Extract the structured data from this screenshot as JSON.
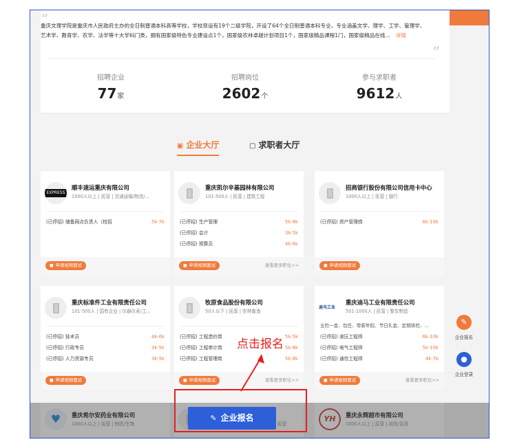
{
  "intro": {
    "text": "重庆文理学院是重庆市人民政府主办的全日制普通本科高等学校，学校现设有19个二级学院，开设了64个全日制普通本科专业，专业涵盖文学、理学、工学、管理学、艺术学、教育学、农学、法学等十大学科门类，拥有国家级特色专业建设点1个，国家级农林卓越计划项目1个，国家级精品课程1门，国家级精品在线...",
    "more_label": "详情"
  },
  "stats": [
    {
      "label": "招聘企业",
      "value": "77",
      "unit": "家"
    },
    {
      "label": "招聘岗位",
      "value": "2602",
      "unit": "个"
    },
    {
      "label": "参与求职者",
      "value": "9612",
      "unit": "人"
    }
  ],
  "tabs": [
    {
      "label": "企业大厅",
      "icon": "building-icon",
      "active": true
    },
    {
      "label": "求职者大厅",
      "icon": "briefcase-icon",
      "active": false
    }
  ],
  "companies": [
    {
      "name": "顺丰速运重庆有限公司",
      "meta": "1000人以上 | 民营 | 交通运输/物流/...",
      "logo": "sf-express-logo",
      "logo_text": "EXPRESS",
      "jobs": [
        {
          "title": "(已停招) 储备网点负责人（校招",
          "salary": "5k-7k"
        }
      ],
      "more_label": ""
    },
    {
      "name": "重庆凯尔辛基园林有限公司",
      "meta": "101-500人 | 民营 | 建筑工程",
      "logo": "building-icon",
      "jobs": [
        {
          "title": "(已停招) 生产管理",
          "salary": "5k-8k"
        },
        {
          "title": "(已停招) 会计",
          "salary": "3k-5k"
        },
        {
          "title": "(已停招) 预算员",
          "salary": "4k-6k"
        }
      ],
      "more_label": "查看更多职位>>"
    },
    {
      "name": "招商银行股份有限公司信用卡中心",
      "meta": "1000人以上 | 民营 | 银行",
      "logo": "building-icon",
      "jobs": [
        {
          "title": "(已停招) 资产管理岗",
          "salary": "6k-10k"
        }
      ],
      "more_label": ""
    },
    {
      "name": "重庆标准件工业有限责任公司",
      "meta": "101-500人 | 国有企业 | 仪器仪表/工...",
      "logo": "building-icon",
      "jobs": [
        {
          "title": "(已停招) 技术员",
          "salary": "4k-6k"
        },
        {
          "title": "(已停招) 行政专员",
          "salary": "3k-5k"
        },
        {
          "title": "(已停招) 人力资源专员",
          "salary": "3k-5k"
        }
      ],
      "more_label": ""
    },
    {
      "name": "牧原食品股份有限公司",
      "meta": "50人以下 | 民营 | 农林畜渔",
      "logo": "building-icon",
      "jobs": [
        {
          "title": "(已停招) 工程造价岗",
          "salary": "5k-5k"
        },
        {
          "title": "(已停招) 工程审计岗",
          "salary": "5k-8k"
        },
        {
          "title": "(已停招) 工程管理岗",
          "salary": "5k-8k"
        }
      ],
      "more_label": "查看更多职位>>"
    },
    {
      "name": "重庆迪马工业有限责任公司",
      "meta": "501-1000人 | 民营 | 整车制造",
      "logo": "dima-logo",
      "logo_text": "迪马工业",
      "benefits": "五险一金、包住、带薪年假、节日礼金、定期体检、...",
      "jobs": [
        {
          "title": "(已停招) 液压工程师",
          "salary": "6k-10k"
        },
        {
          "title": "(已停招) 电气工程师",
          "salary": "5k-10k"
        },
        {
          "title": "(已停招) 通信工程师",
          "salary": "4k-7k"
        }
      ],
      "more_label": "查看更多职位>>"
    }
  ],
  "apply_label": "申请视频面试",
  "bottom_companies": [
    {
      "name": "重庆希尔安药业有限公司",
      "meta": "1000人以上 | 民营 | 制药/生物",
      "logo": "heart-logo"
    },
    {
      "name": "",
      "meta": "民营",
      "logo": "building-icon"
    },
    {
      "name": "重庆永辉超市有限公司",
      "meta": "1000人以上 | 民营 | 商贸/百货",
      "logo": "yh-logo",
      "logo_text": "YH"
    }
  ],
  "register": {
    "label": "企业报名"
  },
  "annotation": {
    "text": "点击报名",
    "color": "#e41e1e"
  },
  "side_actions": [
    {
      "label": "企业报名",
      "color": "#f07a3c",
      "icon": "pencil-icon"
    },
    {
      "label": "企业登录",
      "color": "#2c5fd8",
      "icon": "user-icon"
    }
  ],
  "colors": {
    "accent": "#f07a3c",
    "primary": "#2c5fd8"
  }
}
